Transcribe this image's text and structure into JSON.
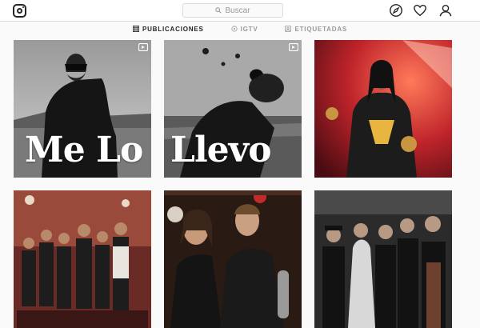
{
  "header": {
    "search_placeholder": "Buscar",
    "icons": [
      "instagram-logo-icon",
      "search-icon",
      "compass-icon",
      "heart-icon",
      "user-icon"
    ]
  },
  "tabs": [
    {
      "label": "PUBLICACIONES",
      "icon": "grid-icon",
      "active": true
    },
    {
      "label": "IGTV",
      "icon": "igtv-icon",
      "active": false
    },
    {
      "label": "ETIQUETADAS",
      "icon": "tag-icon",
      "active": false
    }
  ],
  "posts": [
    {
      "id": "post-1",
      "overlay_text": "Me Lo",
      "has_video": true
    },
    {
      "id": "post-2",
      "overlay_text": "Llevo",
      "has_video": true
    },
    {
      "id": "post-3",
      "overlay_text": "",
      "has_video": false
    },
    {
      "id": "post-4",
      "overlay_text": "",
      "has_video": false
    },
    {
      "id": "post-5",
      "overlay_text": "",
      "has_video": false
    },
    {
      "id": "post-6",
      "overlay_text": "",
      "has_video": false
    }
  ],
  "colors": {
    "text_dark": "#262626",
    "text_muted": "#999999",
    "border": "#dbdbdb",
    "background": "#fafafa"
  }
}
